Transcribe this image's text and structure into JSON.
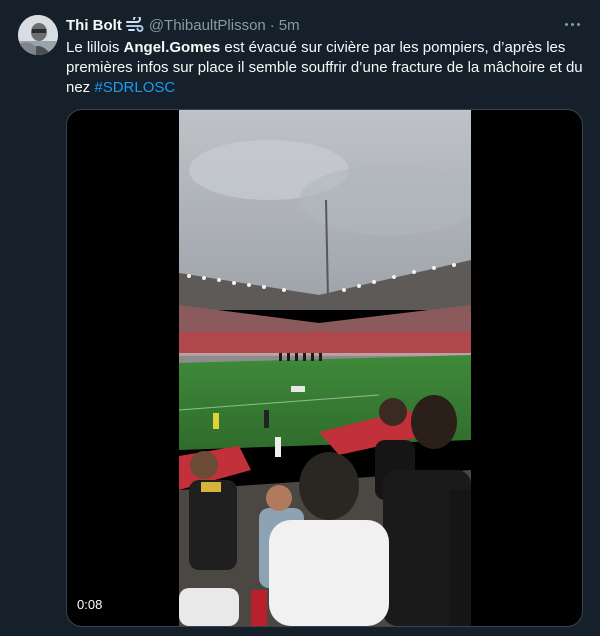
{
  "tweet": {
    "author_name": "Thi Bolt",
    "author_emoji": "dashing-away-icon",
    "handle": "@ThibaultPlisson",
    "separator": "·",
    "time": "5m",
    "text_part1": "Le lillois ",
    "text_bold": "Angel.Gomes",
    "text_part2": " est évacué sur civière par les pompiers, d’après les premières infos sur place il semble souffrir d’une fracture de la mâchoire et du nez ",
    "hashtag": "#SDRLOSC"
  },
  "media": {
    "type": "video",
    "duration": "0:08"
  },
  "colors": {
    "background": "#15202b",
    "text": "#f7f9f9",
    "secondary": "#8b98a5",
    "link": "#1d9bf0"
  }
}
